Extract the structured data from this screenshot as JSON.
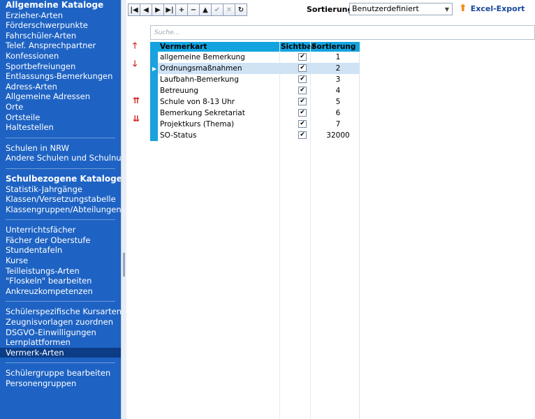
{
  "sidebar": {
    "groups": [
      {
        "header": "Allgemeine Kataloge",
        "items": [
          "Erzieher-Arten",
          "Förderschwerpunkte",
          "Fahrschüler-Arten",
          "Telef. Ansprechpartner",
          "Konfessionen",
          "Sportbefreiungen",
          "Entlassungs-Bemerkungen",
          "Adress-Arten",
          "Allgemeine Adressen",
          "Orte",
          "Ortsteile",
          "Haltestellen"
        ]
      },
      {
        "items": [
          "Schulen in NRW",
          "Andere Schulen und Schulnummern"
        ]
      },
      {
        "header": "Schulbezogene Kataloge",
        "items": [
          "Statistik-Jahrgänge",
          "Klassen/Versetzungstabelle",
          "Klassengruppen/Abteilungen"
        ]
      },
      {
        "items": [
          "Unterrichtsfächer",
          "Fächer der Oberstufe",
          "Stundentafeln",
          "Kurse",
          "Teilleistungs-Arten",
          "\"Floskeln\" bearbeiten",
          "Ankreuzkompetenzen"
        ]
      },
      {
        "items": [
          "Schülerspezifische Kursarten",
          "Zeugnisvorlagen zuordnen",
          "DSGVO-Einwilligungen",
          "Lernplattformen",
          "Vermerk-Arten"
        ]
      },
      {
        "items": [
          "Schülergruppe bearbeiten",
          "Personengruppen"
        ]
      }
    ],
    "active": "Vermerk-Arten"
  },
  "toolbar": {
    "nav_buttons": [
      "|◀",
      "◀",
      "▶",
      "▶|",
      "+",
      "−",
      "▲",
      "✔",
      "✕",
      "↻"
    ],
    "sort_label": "Sortierung",
    "sort_value": "Benutzerdefiniert",
    "excel_label": "Excel-Export"
  },
  "search": {
    "placeholder": "Suche..."
  },
  "grid": {
    "columns": [
      "Vermerkart",
      "Sichtbar",
      "Sortierung"
    ],
    "rows": [
      {
        "name": "allgemeine Bemerkung",
        "visible": "✔",
        "sort": "1"
      },
      {
        "name": "Ordnungsmaßnahmen",
        "visible": "✔",
        "sort": "2"
      },
      {
        "name": "Laufbahn-Bemerkung",
        "visible": "✔",
        "sort": "3"
      },
      {
        "name": "Betreuung",
        "visible": "✔",
        "sort": "4"
      },
      {
        "name": "Schule von 8-13 Uhr",
        "visible": "✔",
        "sort": "5"
      },
      {
        "name": "Bemerkung Sekretariat",
        "visible": "✔",
        "sort": "6"
      },
      {
        "name": "Projektkurs (Thema)",
        "visible": "✔",
        "sort": "7"
      },
      {
        "name": "SO-Status",
        "visible": "✔",
        "sort": "32000"
      }
    ],
    "selected_index": 1
  },
  "colors": {
    "sidebar": "#1e63c4",
    "header": "#13a4e0",
    "accent_red": "#d42020"
  }
}
